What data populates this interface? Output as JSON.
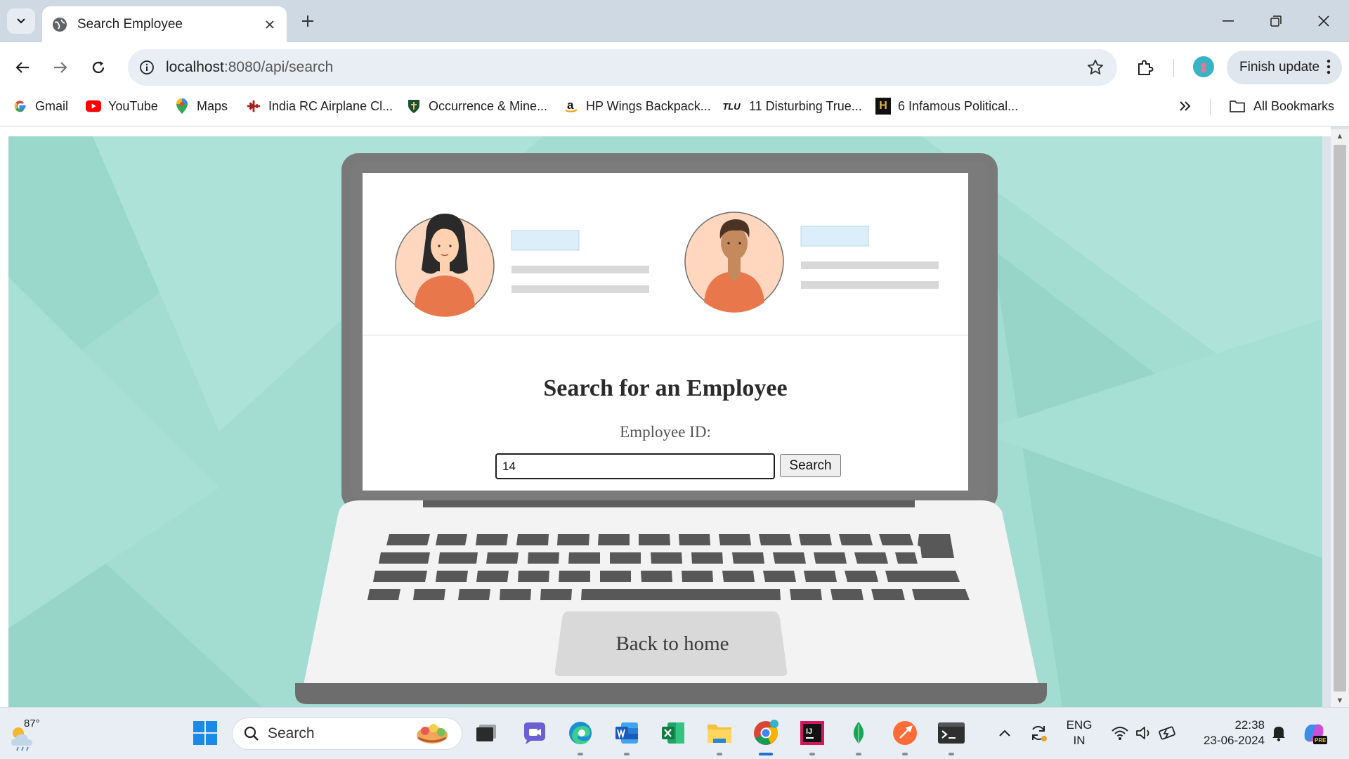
{
  "browser": {
    "tab_title": "Search Employee",
    "url_host": "localhost",
    "url_rest": ":8080/api/search",
    "finish_update_label": "Finish update",
    "bookmarks": [
      {
        "label": "Gmail",
        "icon": "gmail-icon"
      },
      {
        "label": "YouTube",
        "icon": "youtube-icon"
      },
      {
        "label": "Maps",
        "icon": "maps-icon"
      },
      {
        "label": "India RC Airplane Cl...",
        "icon": "airplane-icon"
      },
      {
        "label": "Occurrence & Mine...",
        "icon": "shield-icon"
      },
      {
        "label": "HP Wings Backpack...",
        "icon": "amazon-icon"
      },
      {
        "label": "11 Disturbing True...",
        "icon": "tlu-icon"
      },
      {
        "label": "6 Infamous Political...",
        "icon": "history-icon"
      }
    ],
    "tlu_badge": "TLU",
    "history_badge": "H",
    "all_bookmarks_label": "All Bookmarks"
  },
  "page": {
    "heading": "Search for an Employee",
    "employee_id_label": "Employee ID:",
    "employee_id_value": "14",
    "search_button": "Search",
    "back_button": "Back to home"
  },
  "taskbar": {
    "temperature": "87°",
    "search_placeholder": "Search",
    "language_top": "ENG",
    "language_bottom": "IN",
    "time": "22:38",
    "date": "23-06-2024"
  },
  "colors": {
    "page_background": "#9fdbd0",
    "laptop_frame": "#7a7a7a",
    "avatar_background": "#ffd7bf",
    "shirt": "#e8784c",
    "placeholder_box": "#dbeefa"
  }
}
